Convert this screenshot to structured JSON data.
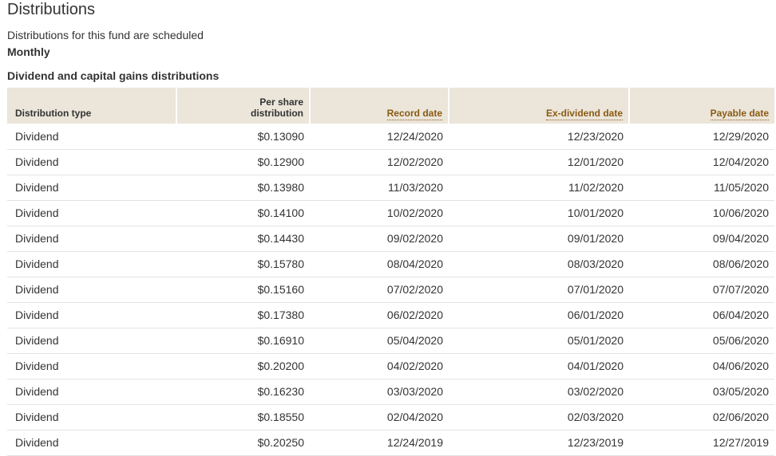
{
  "header": {
    "title": "Distributions",
    "schedule_text": "Distributions for this fund are scheduled",
    "schedule_value": "Monthly"
  },
  "section": {
    "title": "Dividend and capital gains distributions"
  },
  "table": {
    "columns": [
      {
        "label": "Distribution type",
        "sortable": false
      },
      {
        "label_line1": "Per share",
        "label_line2": "distribution",
        "sortable": false
      },
      {
        "label": "Record date",
        "sortable": true
      },
      {
        "label": "Ex-dividend date",
        "sortable": true
      },
      {
        "label": "Payable date",
        "sortable": true
      }
    ],
    "rows": [
      [
        "Dividend",
        "$0.13090",
        "12/24/2020",
        "12/23/2020",
        "12/29/2020"
      ],
      [
        "Dividend",
        "$0.12900",
        "12/02/2020",
        "12/01/2020",
        "12/04/2020"
      ],
      [
        "Dividend",
        "$0.13980",
        "11/03/2020",
        "11/02/2020",
        "11/05/2020"
      ],
      [
        "Dividend",
        "$0.14100",
        "10/02/2020",
        "10/01/2020",
        "10/06/2020"
      ],
      [
        "Dividend",
        "$0.14430",
        "09/02/2020",
        "09/01/2020",
        "09/04/2020"
      ],
      [
        "Dividend",
        "$0.15780",
        "08/04/2020",
        "08/03/2020",
        "08/06/2020"
      ],
      [
        "Dividend",
        "$0.15160",
        "07/02/2020",
        "07/01/2020",
        "07/07/2020"
      ],
      [
        "Dividend",
        "$0.17380",
        "06/02/2020",
        "06/01/2020",
        "06/04/2020"
      ],
      [
        "Dividend",
        "$0.16910",
        "05/04/2020",
        "05/01/2020",
        "05/06/2020"
      ],
      [
        "Dividend",
        "$0.20200",
        "04/02/2020",
        "04/01/2020",
        "04/06/2020"
      ],
      [
        "Dividend",
        "$0.16230",
        "03/03/2020",
        "03/02/2020",
        "03/05/2020"
      ],
      [
        "Dividend",
        "$0.18550",
        "02/04/2020",
        "02/03/2020",
        "02/06/2020"
      ],
      [
        "Dividend",
        "$0.20250",
        "12/24/2019",
        "12/23/2019",
        "12/27/2019"
      ]
    ]
  },
  "colors": {
    "header_bg": "#ebe5da",
    "sort_link": "#8a5a12",
    "text": "#333333",
    "row_divider": "#e3e3e3"
  }
}
